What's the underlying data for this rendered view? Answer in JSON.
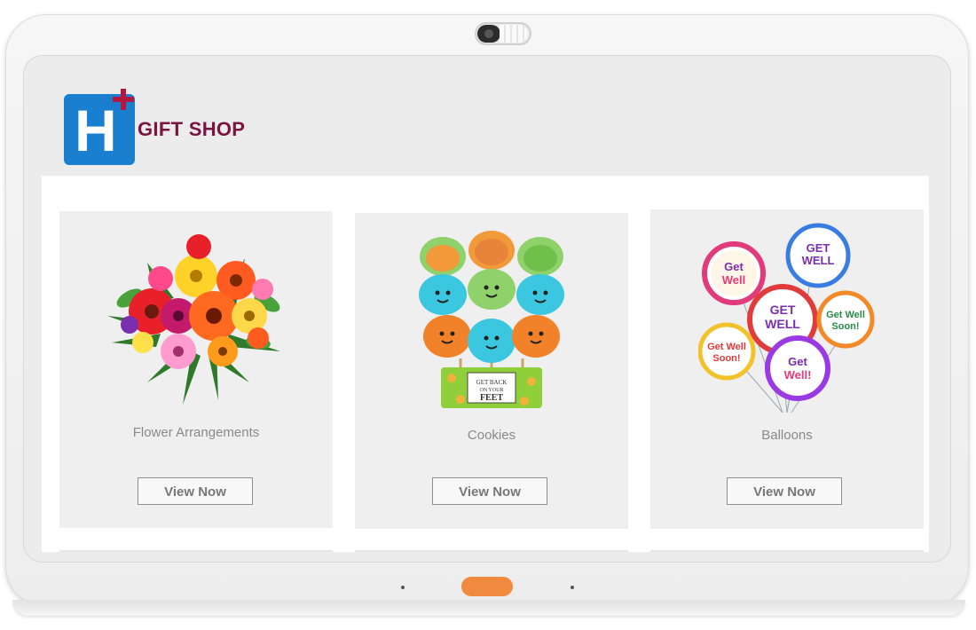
{
  "app": {
    "title": "GIFT SHOP",
    "logo_icon": "hospital-h-plus-icon",
    "colors": {
      "logo_blue": "#1a7fce",
      "logo_plus": "#b3193f",
      "title": "#7a1541",
      "home_button": "#f08a3e"
    }
  },
  "products": [
    {
      "label": "Flower Arrangements",
      "button_label": "View Now",
      "icon": "flower-bouquet-image"
    },
    {
      "label": "Cookies",
      "button_label": "View Now",
      "icon": "foot-cookies-image",
      "tag_text": "GET BACK ON YOUR FEET"
    },
    {
      "label": "Balloons",
      "button_label": "View Now",
      "icon": "get-well-balloons-image",
      "balloon_text": "Get Well Soon!"
    }
  ]
}
